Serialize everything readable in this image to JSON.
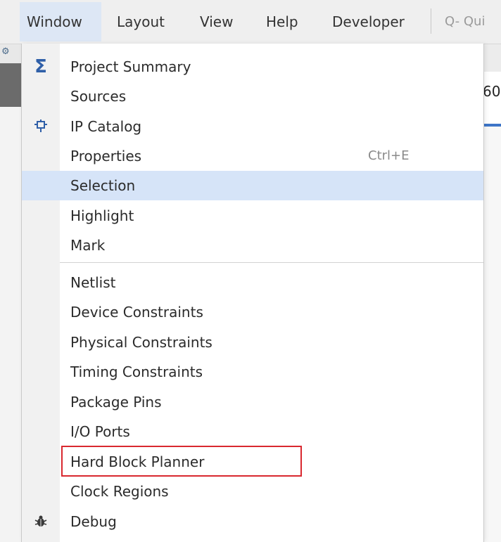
{
  "menubar": {
    "items": [
      {
        "label": "Window",
        "active": true
      },
      {
        "label": "Layout",
        "active": false
      },
      {
        "label": "View",
        "active": false
      },
      {
        "label": "Help",
        "active": false
      },
      {
        "label": "Developer",
        "active": false
      }
    ],
    "quick_access": "Q- Qui"
  },
  "background": {
    "tab_text": "60"
  },
  "window_menu": {
    "items": [
      {
        "label": "Project Summary",
        "icon": "sigma-icon",
        "shortcut": ""
      },
      {
        "label": "Sources",
        "icon": "",
        "shortcut": ""
      },
      {
        "label": "IP Catalog",
        "icon": "ip-chip-icon",
        "shortcut": ""
      },
      {
        "label": "Properties",
        "icon": "",
        "shortcut": "Ctrl+E"
      },
      {
        "label": "Selection",
        "icon": "",
        "shortcut": "",
        "selected": true
      },
      {
        "label": "Highlight",
        "icon": "",
        "shortcut": ""
      },
      {
        "label": "Mark",
        "icon": "",
        "shortcut": ""
      },
      {
        "label": "Netlist",
        "icon": "",
        "shortcut": ""
      },
      {
        "label": "Device Constraints",
        "icon": "",
        "shortcut": ""
      },
      {
        "label": "Physical Constraints",
        "icon": "",
        "shortcut": ""
      },
      {
        "label": "Timing Constraints",
        "icon": "",
        "shortcut": ""
      },
      {
        "label": "Package Pins",
        "icon": "",
        "shortcut": ""
      },
      {
        "label": "I/O Ports",
        "icon": "",
        "shortcut": ""
      },
      {
        "label": "Hard Block Planner",
        "icon": "",
        "shortcut": "",
        "annotated": true
      },
      {
        "label": "Clock Regions",
        "icon": "",
        "shortcut": ""
      },
      {
        "label": "Debug",
        "icon": "bug-icon",
        "shortcut": ""
      }
    ]
  },
  "colors": {
    "selected_item": "#d6e4f8",
    "active_menubar": "#dde7f5",
    "annotation_box": "#d9282f"
  }
}
